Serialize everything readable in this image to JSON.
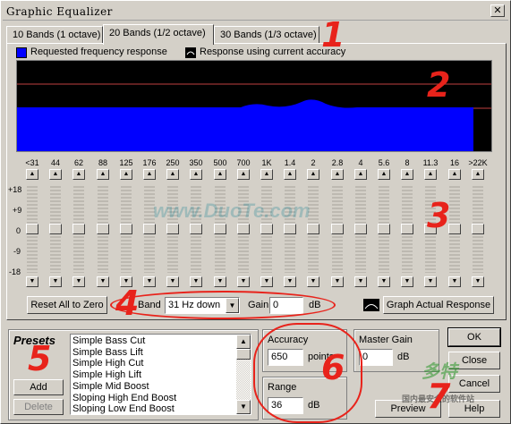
{
  "window": {
    "title": "Graphic Equalizer",
    "close_glyph": "✕"
  },
  "tabs": [
    {
      "label": "10 Bands (1 octave)"
    },
    {
      "label": "20 Bands (1/2 octave)",
      "active": true
    },
    {
      "label": "30 Bands (1/3 octave)"
    }
  ],
  "legend": {
    "requested": "Requested frequency response",
    "actual": "Response using current accuracy",
    "requested_color": "#0000ff"
  },
  "frequency_labels": [
    "<31",
    "44",
    "62",
    "88",
    "125",
    "176",
    "250",
    "350",
    "500",
    "700",
    "1K",
    "1.4",
    "2",
    "2.8",
    "4",
    "5.6",
    "8",
    "11.3",
    "16",
    ">22K"
  ],
  "gain_axis_labels": [
    "+18",
    "+9",
    "0",
    "-9",
    "-18"
  ],
  "band_gains": [
    0,
    0,
    0,
    0,
    0,
    0,
    0,
    0,
    0,
    0,
    0,
    0,
    0,
    0,
    0,
    0,
    0,
    0,
    0,
    0
  ],
  "controls": {
    "reset_all": "Reset All to Zero",
    "band_label": "Band",
    "band_value": "31 Hz down",
    "gain_label": "Gain",
    "gain_value": "0",
    "gain_unit": "dB",
    "graph_actual": "Graph Actual Response"
  },
  "presets": {
    "title": "Presets",
    "items": [
      "Simple Bass Cut",
      "Simple Bass Lift",
      "Simple High Cut",
      "Simple High Lift",
      "Simple Mid Boost",
      "Sloping High End Boost",
      "Sloping Low End Boost"
    ],
    "add": "Add",
    "delete": "Delete"
  },
  "accuracy": {
    "label": "Accuracy",
    "value": "650",
    "unit": "points"
  },
  "range": {
    "label": "Range",
    "value": "36",
    "unit": "dB"
  },
  "master_gain": {
    "label": "Master Gain",
    "value": "0",
    "unit": "dB"
  },
  "buttons": {
    "ok": "OK",
    "close": "Close",
    "cancel": "Cancel",
    "preview": "Preview",
    "help": "Help"
  },
  "annotations": [
    "1",
    "2",
    "3",
    "4",
    "5",
    "6",
    "7"
  ],
  "watermarks": {
    "site": "www.DuoTe.com",
    "brand": "多特",
    "brand_sub": "国内最安全的软件站"
  },
  "colors": {
    "accent_red": "#e8231b",
    "graph_bg": "#000000",
    "graph_fill": "#0000ff"
  }
}
